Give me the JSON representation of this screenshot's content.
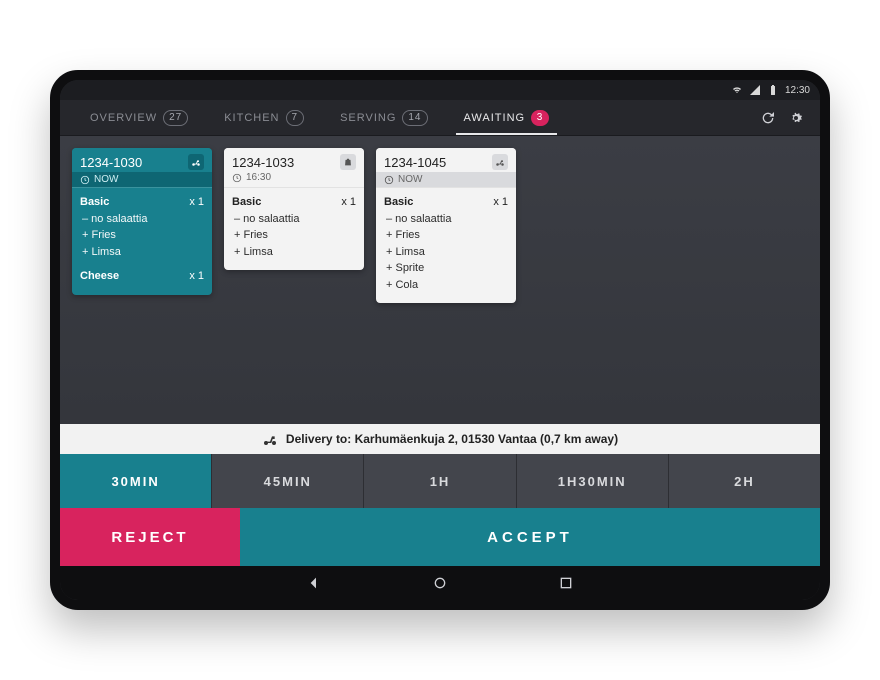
{
  "status": {
    "time": "12:30"
  },
  "tabs": [
    {
      "label": "OVERVIEW",
      "count": "27",
      "active": false
    },
    {
      "label": "KITCHEN",
      "count": "7",
      "active": false
    },
    {
      "label": "SERVING",
      "count": "14",
      "active": false
    },
    {
      "label": "AWAITING",
      "count": "3",
      "active": true,
      "alert": true
    }
  ],
  "cards": [
    {
      "selected": true,
      "id": "1234-1030",
      "time_label": "NOW",
      "icon": "scooter",
      "items": [
        {
          "name": "Basic",
          "qty": "x 1",
          "mods": [
            "– no salaattia",
            "+ Fries",
            "+ Limsa"
          ]
        },
        {
          "name": "Cheese",
          "qty": "x 1",
          "mods": []
        }
      ]
    },
    {
      "selected": false,
      "id": "1234-1033",
      "time_label": "16:30",
      "icon": "bag",
      "items": [
        {
          "name": "Basic",
          "qty": "x 1",
          "mods": [
            "– no salaattia",
            "+ Fries",
            "+ Limsa"
          ]
        }
      ]
    },
    {
      "selected": false,
      "id": "1234-1045",
      "time_label": "NOW",
      "icon": "scooter",
      "items": [
        {
          "name": "Basic",
          "qty": "x 1",
          "mods": [
            "– no salaattia",
            "+ Fries",
            "+ Limsa",
            "+ Sprite",
            "+ Cola"
          ]
        }
      ]
    }
  ],
  "delivery": {
    "label": "Delivery to: Karhumäenkuja 2, 01530 Vantaa (0,7 km away)"
  },
  "times": [
    {
      "label": "30MIN",
      "selected": true
    },
    {
      "label": "45MIN",
      "selected": false
    },
    {
      "label": "1H",
      "selected": false
    },
    {
      "label": "1H30MIN",
      "selected": false
    },
    {
      "label": "2H",
      "selected": false
    }
  ],
  "actions": {
    "accept": "ACCEPT",
    "reject": "REJECT"
  }
}
